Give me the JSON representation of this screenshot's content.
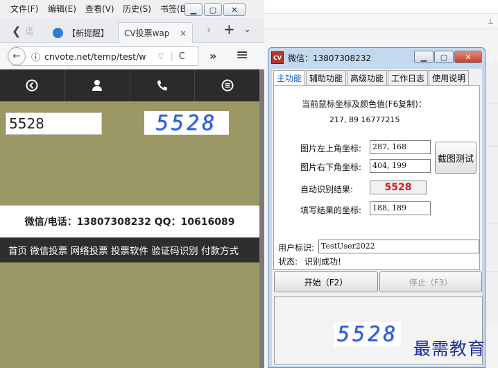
{
  "browser": {
    "menu": [
      "文件(F)",
      "编辑(E)",
      "查看(V)",
      "历史(S)",
      "书签(B)"
    ],
    "tabs": [
      {
        "label": "【新提醒】"
      },
      {
        "label": "CV投票wap"
      }
    ],
    "tab_close": "×",
    "url": "cnvote.net/temp/test/w",
    "url_info": "ⓘ",
    "overflow": "»",
    "menu_icon": "≡",
    "reload": "C",
    "code_input_value": "5528",
    "captcha_text": "5528",
    "contact_text": "微信/电话：13807308232   QQ：10616089",
    "bottom_nav": "首页 微信投票 网络投票 投票软件 验证码识别 付款方式"
  },
  "app": {
    "title": "微信：13807308232",
    "icon_text": "CV",
    "tabs": [
      "主功能",
      "辅助功能",
      "高级功能",
      "工作日志",
      "使用说明"
    ],
    "coords_heading": "当前鼠标坐标及颜色值(F6复制)：",
    "coords_value": "217, 89 16777215",
    "top_left_label": "图片左上角坐标:",
    "top_left_value": "287, 168",
    "bottom_right_label": "图片右下角坐标:",
    "bottom_right_value": "404, 199",
    "crop_button": "截图测试",
    "result_label": "自动识别结果:",
    "result_value": "5528",
    "fill_label": "填写结果的坐标:",
    "fill_value": "188, 189",
    "user_label": "用户标识:",
    "user_value": "TestUser2022",
    "status_label": "状态:",
    "status_value": "识别成功!",
    "start_button": "开始（F2）",
    "stop_button": "停止（F3）",
    "preview_text": "5528"
  },
  "watermark": "最需教育",
  "colors": {
    "page_bg": "#9b9865",
    "result_red": "#e0161b",
    "captcha_blue": "#2a5bd8",
    "watermark_blue": "#1e2fa0"
  }
}
